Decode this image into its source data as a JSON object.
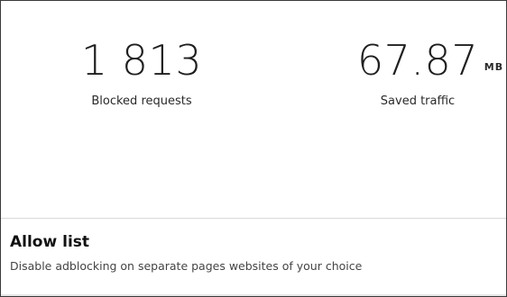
{
  "stats": {
    "blocked": {
      "value": "1 813",
      "label": "Blocked requests"
    },
    "saved": {
      "value": "67.87",
      "unit": "MB",
      "label": "Saved traffic"
    }
  },
  "allow_list": {
    "title": "Allow list",
    "description": "Disable adblocking on separate pages websites of your choice"
  }
}
